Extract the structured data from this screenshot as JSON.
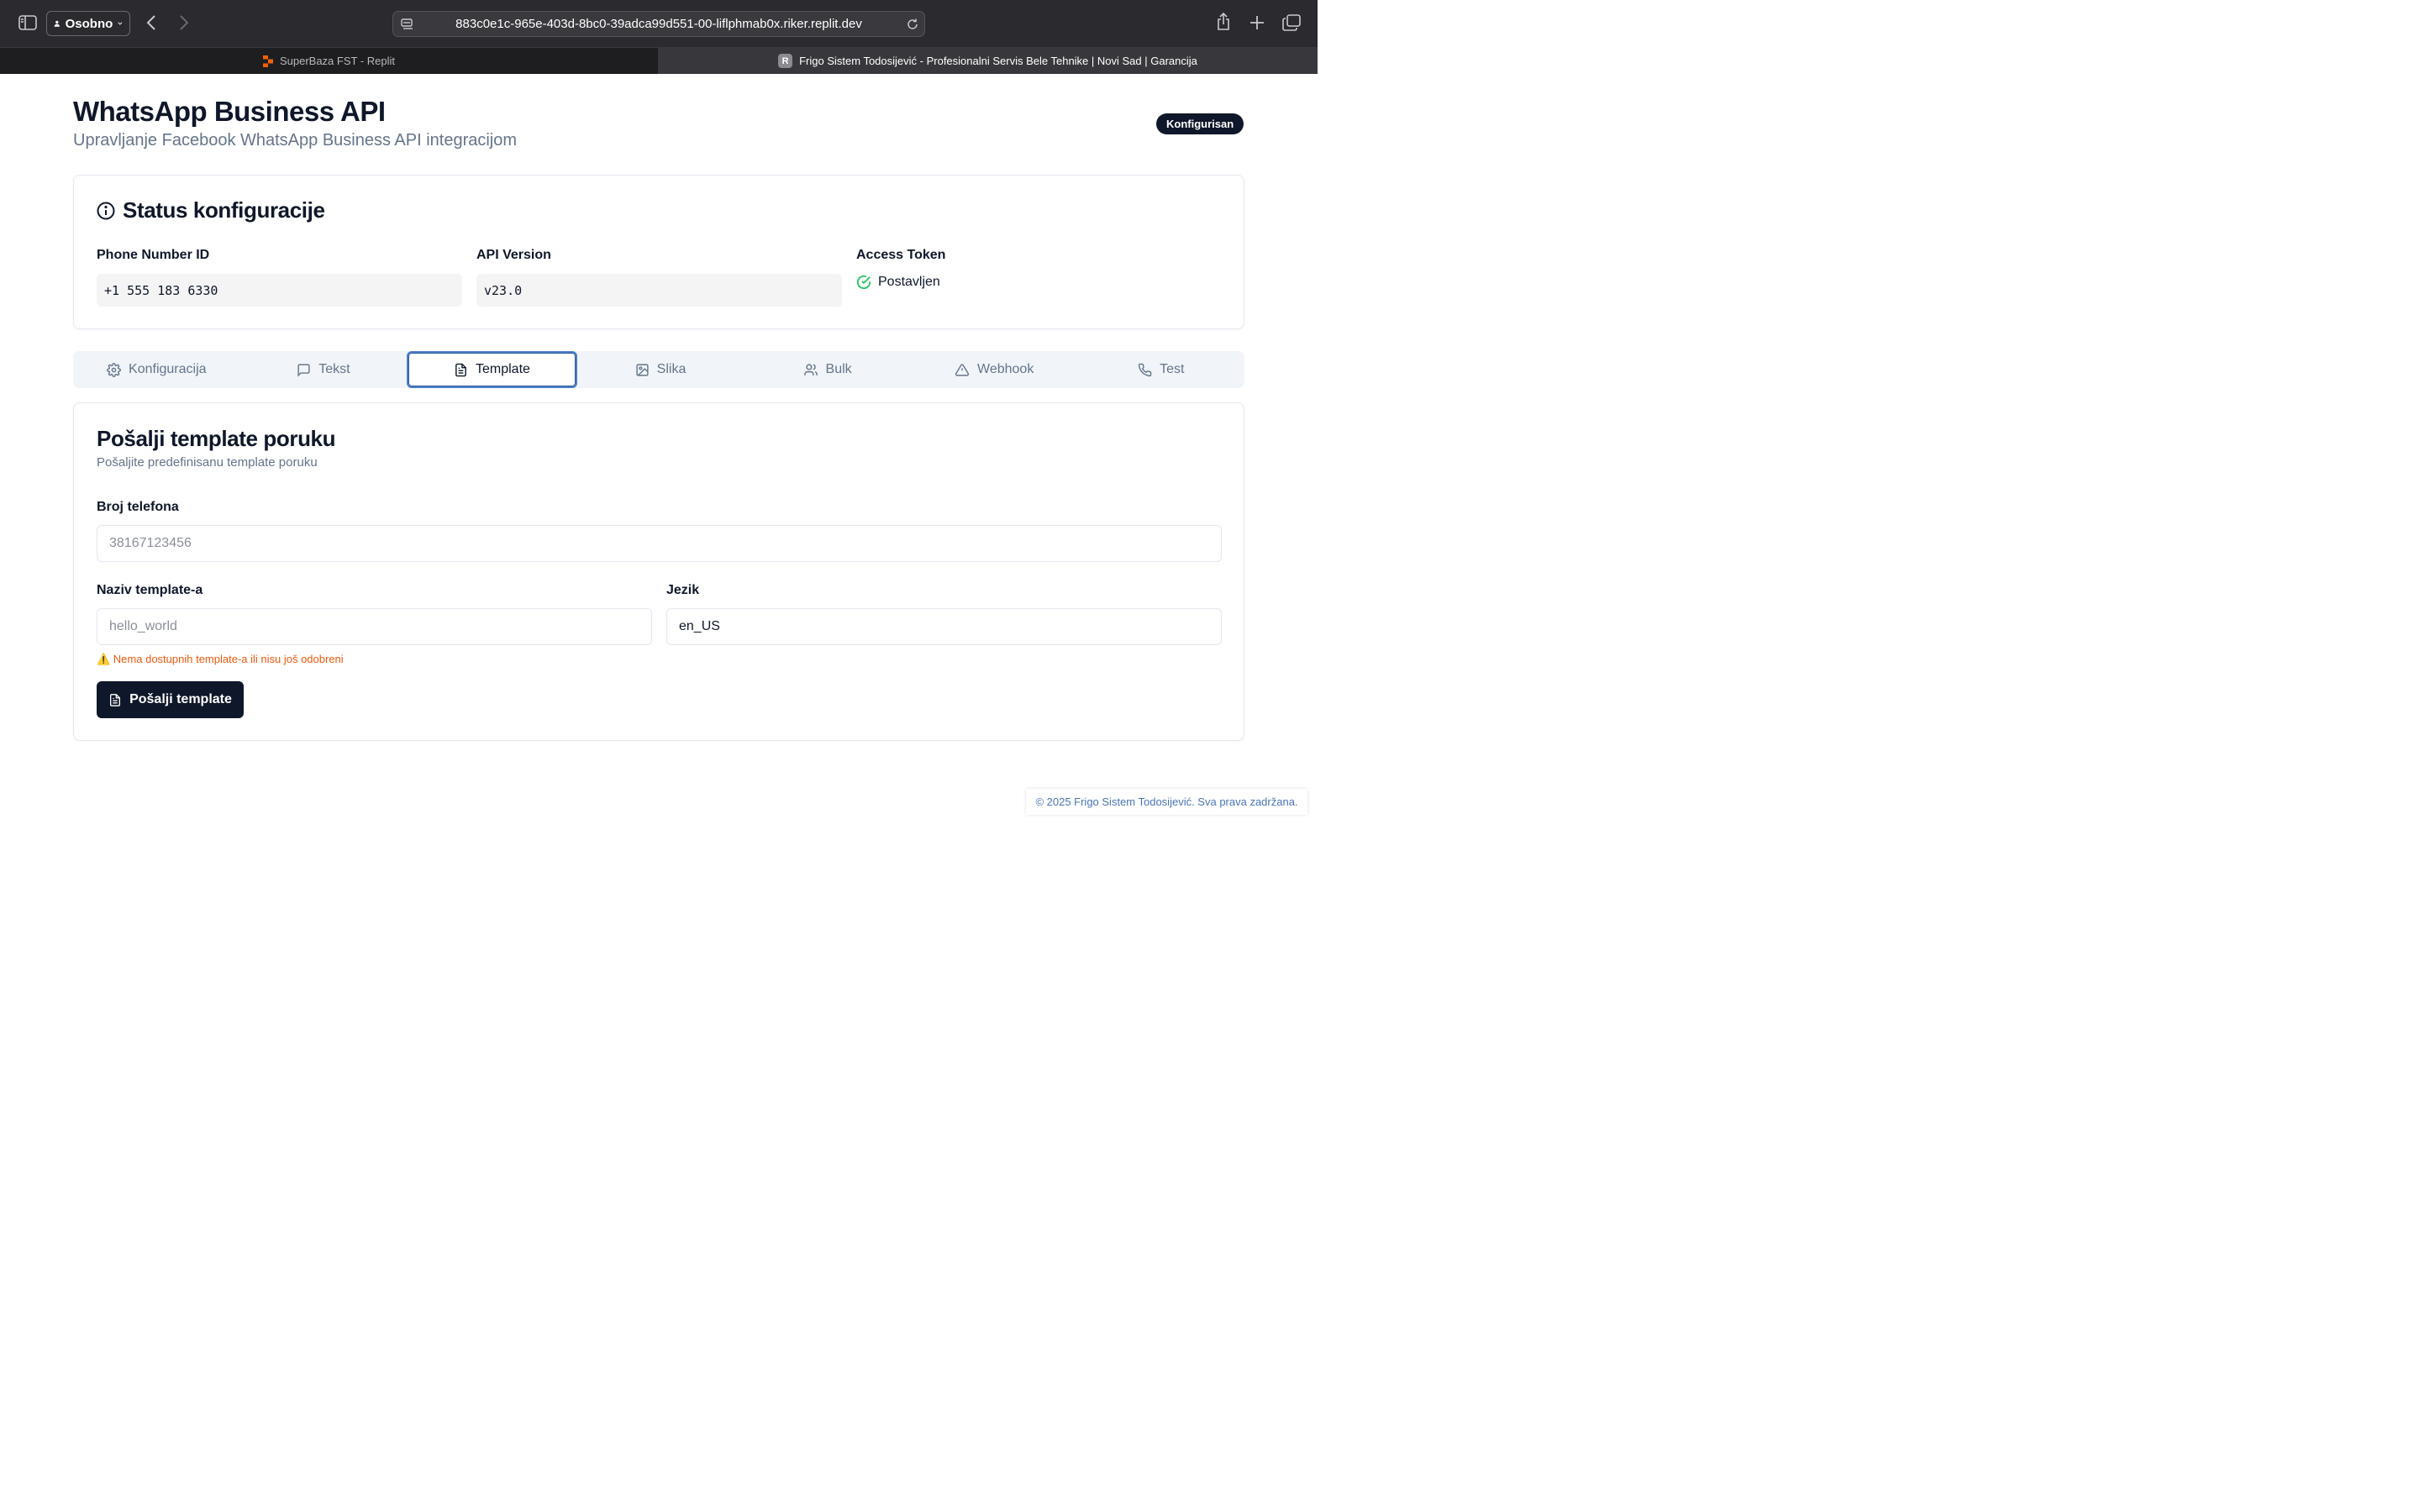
{
  "browser": {
    "profile_label": "Osobno",
    "url": "883c0e1c-965e-403d-8bc0-39adca99d551-00-liflphmab0x.riker.replit.dev",
    "tabs": [
      {
        "title": "SuperBaza FST - Replit",
        "active": false
      },
      {
        "title": "Frigo Sistem Todosijević - Profesionalni Servis Bele Tehnike | Novi Sad | Garancija",
        "favicon_letter": "R",
        "active": true
      }
    ]
  },
  "header": {
    "title": "WhatsApp Business API",
    "subtitle": "Upravljanje Facebook WhatsApp Business API integracijom",
    "badge": "Konfigurisan"
  },
  "status": {
    "heading": "Status konfiguracije",
    "phone_label": "Phone Number ID",
    "phone_value": "+1 555 183 6330",
    "api_label": "API Version",
    "api_value": "v23.0",
    "token_label": "Access Token",
    "token_state": "Postavljen"
  },
  "tabs": [
    {
      "label": "Konfiguracija",
      "icon": "gear-icon"
    },
    {
      "label": "Tekst",
      "icon": "message-icon"
    },
    {
      "label": "Template",
      "icon": "document-icon",
      "active": true
    },
    {
      "label": "Slika",
      "icon": "image-icon"
    },
    {
      "label": "Bulk",
      "icon": "users-icon"
    },
    {
      "label": "Webhook",
      "icon": "warning-icon"
    },
    {
      "label": "Test",
      "icon": "phone-icon"
    }
  ],
  "form": {
    "title": "Pošalji template poruku",
    "subtitle": "Pošaljite predefinisanu template poruku",
    "phone_label": "Broj telefona",
    "phone_placeholder": "38167123456",
    "template_label": "Naziv template-a",
    "template_placeholder": "hello_world",
    "language_label": "Jezik",
    "language_value": "en_US",
    "warning": "⚠️ Nema dostupnih template-a ili nisu još odobreni",
    "submit_label": "Pošalji template"
  },
  "footer": {
    "text": "© 2025 Frigo Sistem Todosijević. Sva prava zadržana."
  },
  "colors": {
    "primary": "#0f172a",
    "accent_focus": "#4a7fc7",
    "warning": "#ea580c",
    "success": "#22c55e",
    "footer_link": "#4a74b8"
  }
}
